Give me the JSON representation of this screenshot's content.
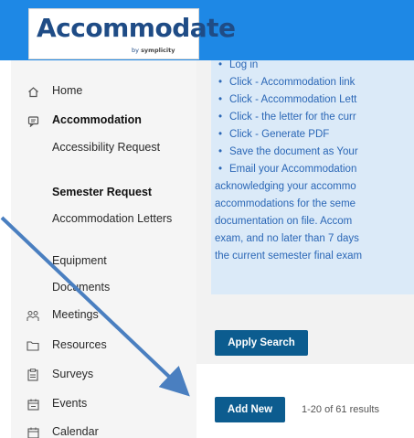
{
  "header": {
    "logo_text": "Accommodate",
    "logo_sub_prefix": "by",
    "logo_sub_brand": "symplicity"
  },
  "sidebar": {
    "items": [
      {
        "label": "Home",
        "icon": "home-icon"
      },
      {
        "label": "Accommodation",
        "icon": "comment-icon"
      },
      {
        "label": "Meetings",
        "icon": "people-icon"
      },
      {
        "label": "Resources",
        "icon": "folder-icon"
      },
      {
        "label": "Surveys",
        "icon": "clipboard-icon"
      },
      {
        "label": "Events",
        "icon": "calendar-icon"
      },
      {
        "label": "Calendar",
        "icon": "calendar-icon"
      }
    ],
    "sub_items": [
      {
        "label": "Accessibility Request"
      },
      {
        "label": "Semester Request"
      },
      {
        "label": "Accommodation Letters"
      },
      {
        "label": "Equipment"
      },
      {
        "label": "Documents"
      }
    ]
  },
  "info": {
    "lines": [
      "Log in",
      "Click - Accommodation link",
      "Click - Accommodation Lett",
      "Click - the letter for the curr",
      "Click - Generate PDF",
      "Save the document as Your",
      "Email your Accommodation"
    ],
    "para": [
      "acknowledging your accommo",
      "accommodations for the seme",
      "documentation on file. Accom",
      "exam, and no later than 7 days",
      "the current semester final exam"
    ]
  },
  "main": {
    "apply_search_label": "Apply Search",
    "add_new_label": "Add New",
    "results_text": "1-20 of 61 results"
  },
  "colors": {
    "header": "#1e88e5",
    "button": "#0c5c8f",
    "info_bg": "#dbeaf8",
    "info_text": "#2b67b6",
    "arrow": "#4a7fc0"
  }
}
